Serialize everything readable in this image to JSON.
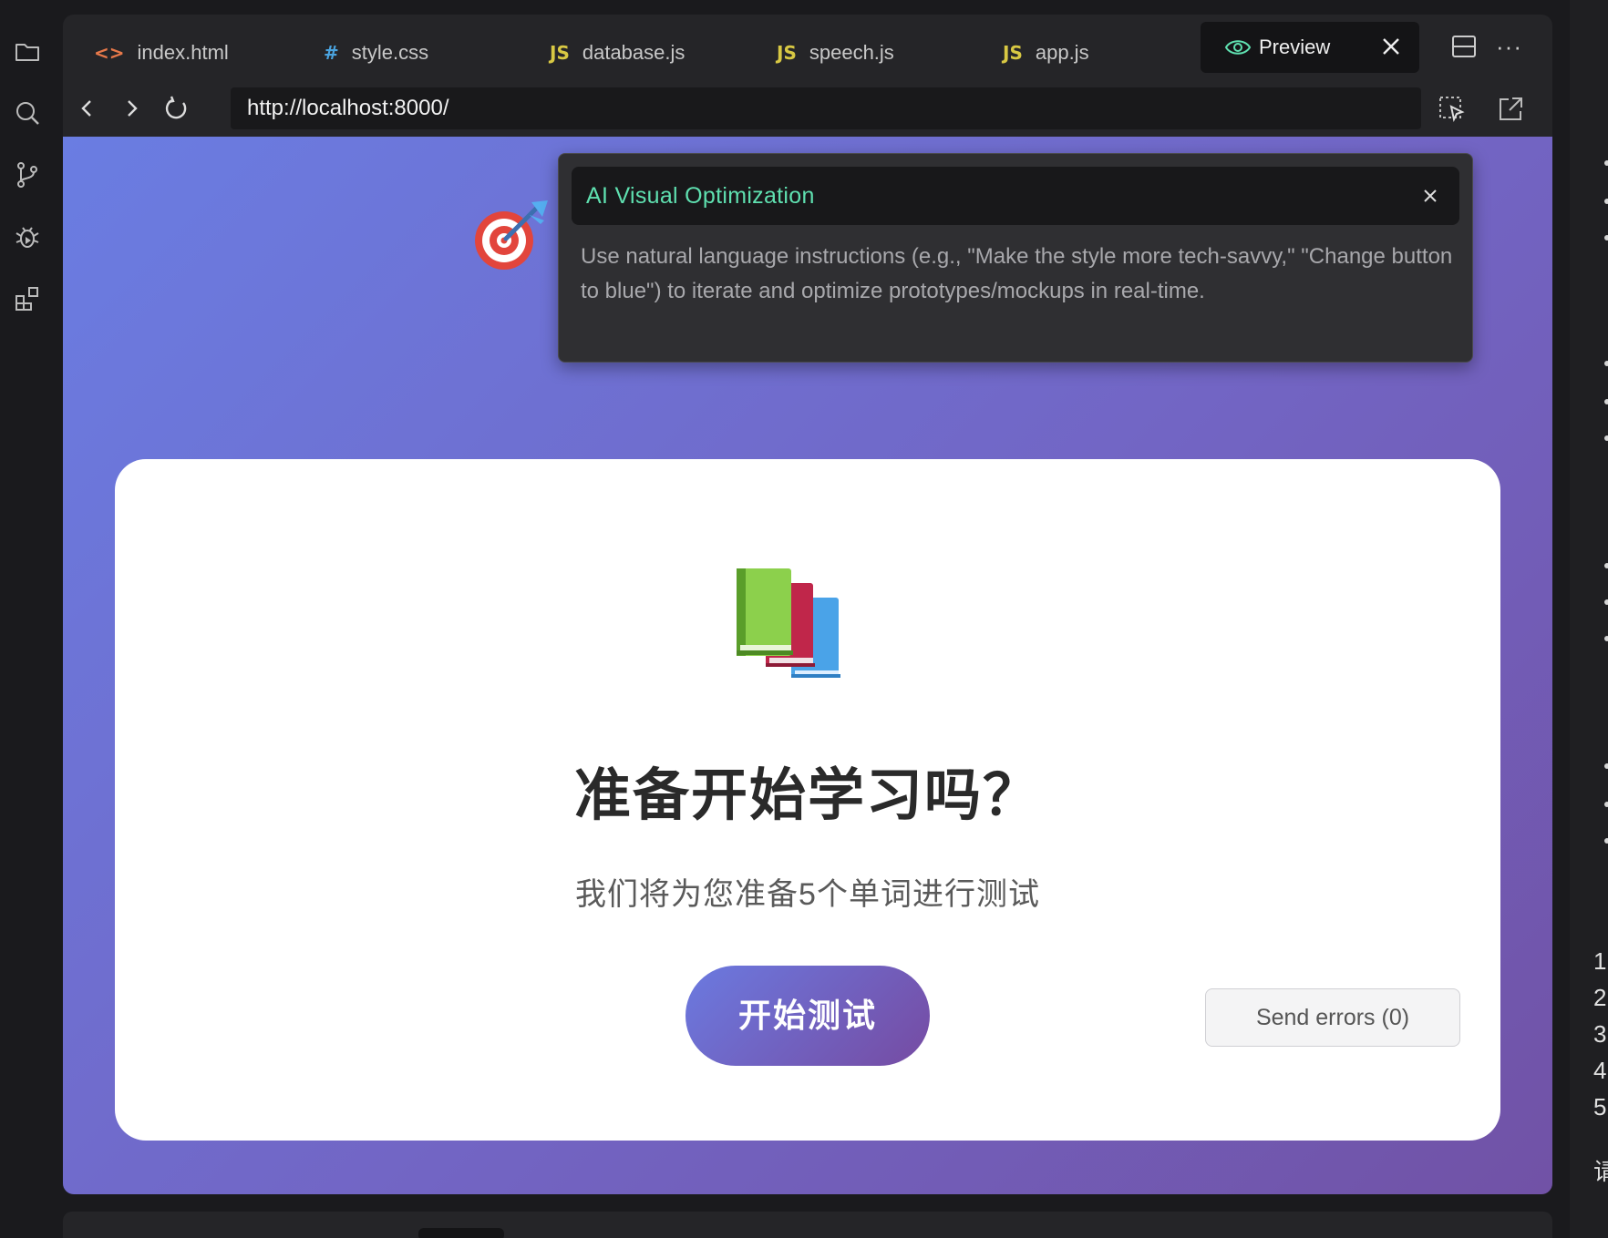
{
  "tabs": [
    {
      "label": "index.html",
      "icon": "<>",
      "icon_color": "#e8794a"
    },
    {
      "label": "style.css",
      "icon": "#",
      "icon_color": "#4aa3df"
    },
    {
      "label": "database.js",
      "icon": "JS",
      "icon_color": "#d8c843"
    },
    {
      "label": "speech.js",
      "icon": "JS",
      "icon_color": "#d8c843"
    },
    {
      "label": "app.js",
      "icon": "JS",
      "icon_color": "#d8c843"
    }
  ],
  "preview_tab": {
    "label": "Preview",
    "icon": "eye-icon"
  },
  "url": "http://localhost:8000/",
  "ai_panel": {
    "title": "AI Visual Optimization",
    "description": "Use natural language instructions (e.g., \"Make the style more tech-savvy,\" \"Change button to blue\") to iterate and optimize prototypes/mockups in real-time."
  },
  "card": {
    "title": "准备开始学习吗？",
    "subtitle": "我们将为您准备5个单词进行测试",
    "start_button": "开始测试"
  },
  "send_errors": "Send errors (0)",
  "right_panel_glyphs": [
    "1",
    "2",
    "3",
    "4",
    "5",
    "请"
  ],
  "colors": {
    "accent_green": "#5fe0b0",
    "gradient_start": "#667eea",
    "gradient_end": "#764ba2"
  }
}
